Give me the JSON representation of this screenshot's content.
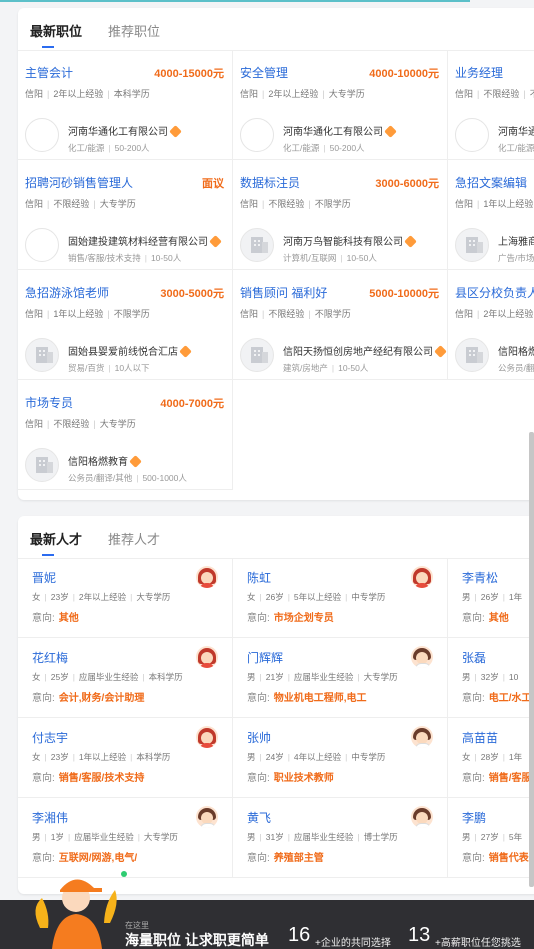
{
  "jobs_section": {
    "tabs": [
      "最新职位",
      "推荐职位"
    ],
    "items": [
      {
        "title": "主管会计",
        "salary": "4000-15000元",
        "req": [
          "信阳",
          "2年以上经验",
          "本科学历"
        ],
        "company": "河南华通化工有限公司",
        "cinfo": [
          "化工/能源",
          "50-200人"
        ],
        "logo": "blank"
      },
      {
        "title": "安全管理",
        "salary": "4000-10000元",
        "req": [
          "信阳",
          "2年以上经验",
          "大专学历"
        ],
        "company": "河南华通化工有限公司",
        "cinfo": [
          "化工/能源",
          "50-200人"
        ],
        "logo": "blank"
      },
      {
        "title": "业务经理",
        "salary": "",
        "req": [
          "信阳",
          "不限经验",
          "不"
        ],
        "company": "河南华通",
        "cinfo": [
          "化工/能源",
          ""
        ],
        "logo": "blank"
      },
      {
        "title": "招聘河砂销售管理人",
        "salary": "面议",
        "req": [
          "信阳",
          "不限经验",
          "大专学历"
        ],
        "company": "固始建投建筑材料经营有限公司",
        "cinfo": [
          "销售/客服/技术支持",
          "10-50人"
        ],
        "logo": "blank"
      },
      {
        "title": "数据标注员",
        "salary": "3000-6000元",
        "req": [
          "信阳",
          "不限经验",
          "不限学历"
        ],
        "company": "河南万鸟智能科技有限公司",
        "cinfo": [
          "计算机/互联网",
          "10-50人"
        ],
        "logo": "building"
      },
      {
        "title": "急招文案编辑",
        "salary": "",
        "req": [
          "信阳",
          "1年以上经验",
          ""
        ],
        "company": "上海雅商",
        "cinfo": [
          "广告/市场",
          ""
        ],
        "logo": "building"
      },
      {
        "title": "急招游泳馆老师",
        "salary": "3000-5000元",
        "req": [
          "信阳",
          "1年以上经验",
          "不限学历"
        ],
        "company": "固始县婴爱前线悦合汇店",
        "cinfo": [
          "贸易/百货",
          "10人以下"
        ],
        "logo": "building"
      },
      {
        "title": "销售顾问 福利好",
        "salary": "5000-10000元",
        "req": [
          "信阳",
          "不限经验",
          "不限学历"
        ],
        "company": "信阳天扬恒创房地产经纪有限公司",
        "cinfo": [
          "建筑/房地产",
          "10-50人"
        ],
        "logo": "building"
      },
      {
        "title": "县区分校负责人",
        "salary": "",
        "req": [
          "信阳",
          "2年以上经验",
          ""
        ],
        "company": "信阳格燃",
        "cinfo": [
          "公务员/翻",
          ""
        ],
        "logo": "building"
      },
      {
        "title": "市场专员",
        "salary": "4000-7000元",
        "req": [
          "信阳",
          "不限经验",
          "大专学历"
        ],
        "company": "信阳格燃教育",
        "cinfo": [
          "公务员/翻译/其他",
          "500-1000人"
        ],
        "logo": "building"
      }
    ]
  },
  "talent_section": {
    "tabs": [
      "最新人才",
      "推荐人才"
    ],
    "intent_label": "意向:",
    "items": [
      {
        "name": "晋妮",
        "info": [
          "女",
          "23岁",
          "2年以上经验",
          "大专学历"
        ],
        "intent": "其他",
        "gender": "f"
      },
      {
        "name": "陈虹",
        "info": [
          "女",
          "26岁",
          "5年以上经验",
          "中专学历"
        ],
        "intent": "市场企划专员",
        "gender": "f"
      },
      {
        "name": "李青松",
        "info": [
          "男",
          "26岁",
          "1年"
        ],
        "intent": "其他",
        "gender": "m"
      },
      {
        "name": "花红梅",
        "info": [
          "女",
          "25岁",
          "应届毕业生经验",
          "本科学历"
        ],
        "intent": "会计,财务/会计助理",
        "gender": "f"
      },
      {
        "name": "门辉辉",
        "info": [
          "男",
          "21岁",
          "应届毕业生经验",
          "大专学历"
        ],
        "intent": "物业机电工程师,电工",
        "gender": "m"
      },
      {
        "name": "张磊",
        "info": [
          "男",
          "32岁",
          "10"
        ],
        "intent": "电工/水工",
        "gender": "m"
      },
      {
        "name": "付志宇",
        "info": [
          "女",
          "23岁",
          "1年以上经验",
          "本科学历"
        ],
        "intent": "销售/客服/技术支持",
        "gender": "f"
      },
      {
        "name": "张帅",
        "info": [
          "男",
          "24岁",
          "4年以上经验",
          "中专学历"
        ],
        "intent": "职业技术教师",
        "gender": "m"
      },
      {
        "name": "高苗苗",
        "info": [
          "女",
          "28岁",
          "1年"
        ],
        "intent": "销售/客服",
        "gender": "f"
      },
      {
        "name": "李湘伟",
        "info": [
          "男",
          "1岁",
          "应届毕业生经验",
          "大专学历"
        ],
        "intent": "互联网/网游,电气/",
        "gender": "m"
      },
      {
        "name": "黄飞",
        "info": [
          "男",
          "31岁",
          "应届毕业生经验",
          "博士学历"
        ],
        "intent": "养殖部主管",
        "gender": "m"
      },
      {
        "name": "李鹏",
        "info": [
          "男",
          "27岁",
          "5年"
        ],
        "intent": "销售代表,",
        "gender": "m"
      }
    ]
  },
  "banner": {
    "small": "在这里",
    "headline": "海量职位 让求职更简单",
    "num1": "16",
    "sub1": "+企业的共同选择",
    "num2": "13",
    "sub2": "+高薪职位任您挑选"
  },
  "colors": {
    "link": "#2a6ad8",
    "salary": "#f06b1a",
    "accent": "#2b6cf0"
  }
}
